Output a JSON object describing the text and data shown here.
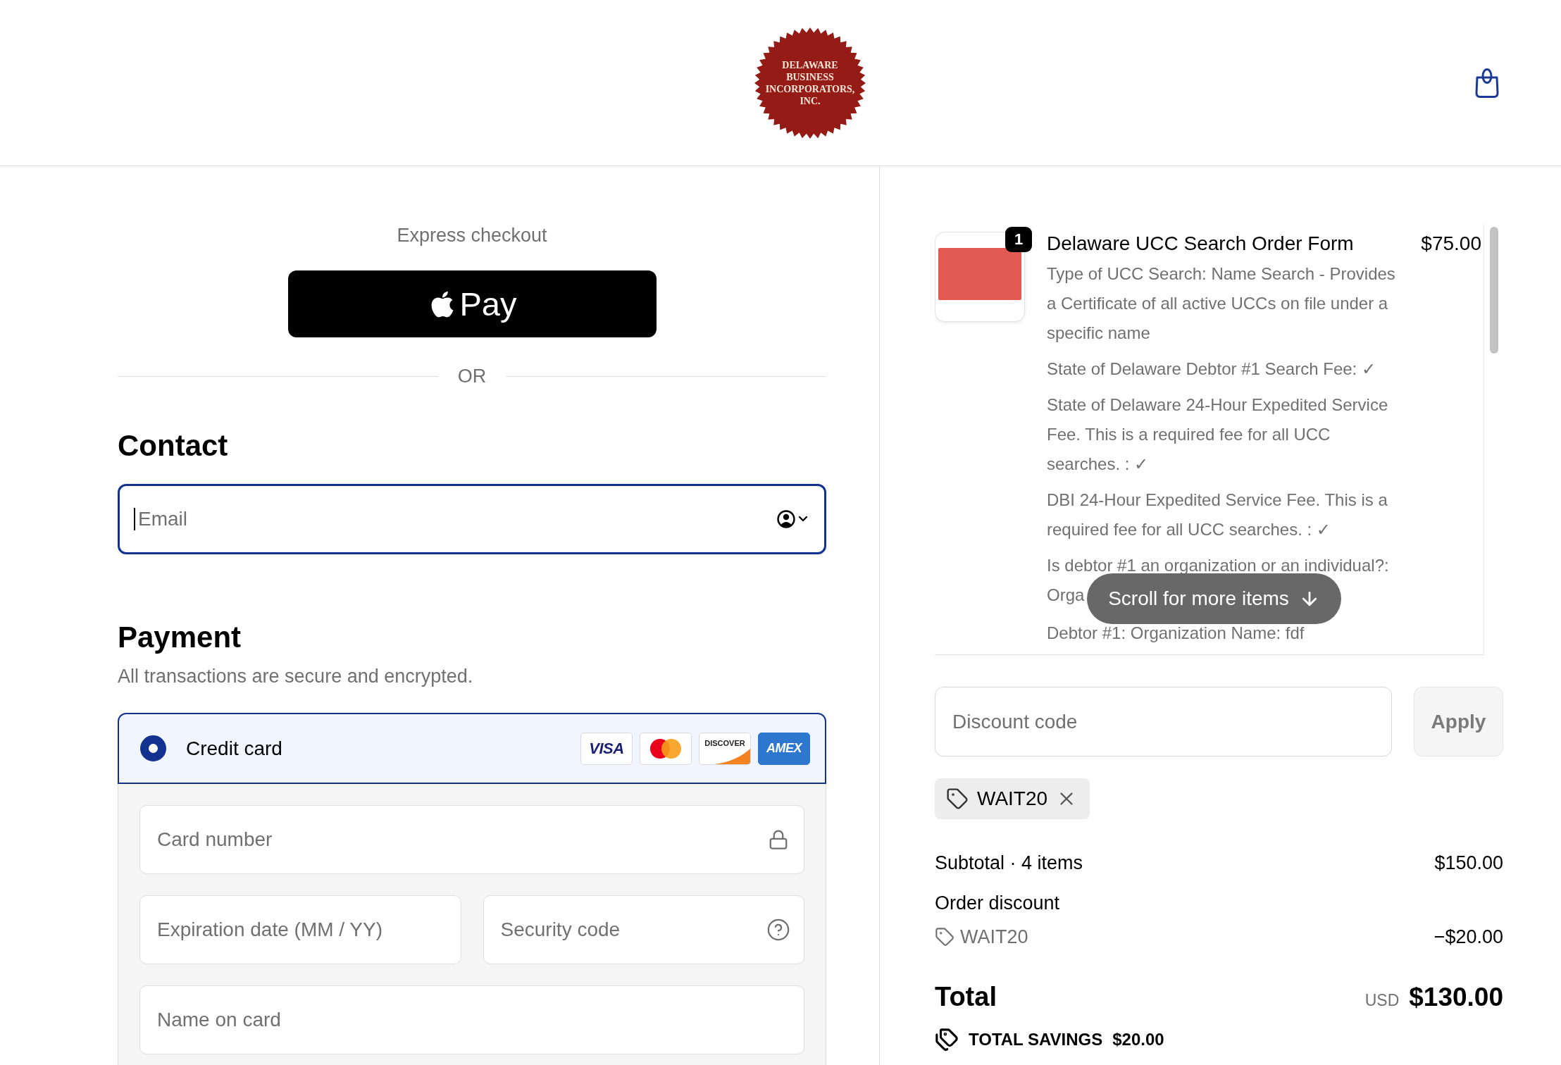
{
  "header": {
    "logo_lines": [
      "DELAWARE",
      "BUSINESS",
      "INCORPORATORS,",
      "INC."
    ]
  },
  "express_checkout": {
    "title": "Express checkout",
    "wallet_button": {
      "label": "Pay"
    },
    "separator": "OR"
  },
  "contact": {
    "heading": "Contact",
    "email": {
      "placeholder": "Email",
      "focused": true
    }
  },
  "payment": {
    "heading": "Payment",
    "subtitle": "All transactions are secure and encrypted.",
    "methods": [
      {
        "label": "Credit card",
        "selected": true,
        "card_brands": [
          {
            "kind": "visa",
            "label": "VISA"
          },
          {
            "kind": "mastercard"
          },
          {
            "kind": "discover",
            "label": "DISCOVER"
          },
          {
            "kind": "amex",
            "label": "AMEX"
          }
        ]
      }
    ],
    "card_fields": {
      "card_number": {
        "placeholder": "Card number"
      },
      "expiration": {
        "placeholder": "Expiration date (MM / YY)"
      },
      "security_code": {
        "placeholder": "Security code"
      },
      "name_on_card": {
        "placeholder": "Name on card"
      }
    }
  },
  "order_summary": {
    "items": [
      {
        "quantity": "1",
        "title": "Delaware UCC Search Order Form",
        "price": "$75.00",
        "details": [
          {
            "text": "Type of UCC Search: Name Search - Provides a Certificate of all active UCCs on file under a specific name"
          },
          {
            "text": "State of Delaware Debtor #1 Search Fee: ✓"
          },
          {
            "text": "State of Delaware 24-Hour Expedited Service Fee. This is a required fee for all UCC searches. : ✓"
          },
          {
            "text": "DBI 24-Hour Expedited Service Fee. This is a required fee for all UCC searches. : ✓"
          },
          {
            "lines": [
              "Is debtor #1 an organization or an individual?:",
              "Orga"
            ]
          },
          {
            "text": "Debtor #1: Organization Name: fdf"
          }
        ]
      }
    ],
    "scroll_hint": "Scroll for more items",
    "discount": {
      "placeholder": "Discount code",
      "apply_button": {
        "label": "Apply",
        "disabled": true
      },
      "applied_codes": [
        {
          "code": "WAIT20"
        }
      ]
    },
    "subtotal": {
      "label": "Subtotal · 4 items",
      "value": "$150.00"
    },
    "order_discount": {
      "label": "Order discount",
      "code": "WAIT20",
      "value": "−$20.00"
    },
    "total": {
      "label": "Total",
      "currency": "USD",
      "value": "$130.00"
    },
    "savings": {
      "label": "TOTAL SAVINGS",
      "value": "$20.00"
    }
  }
}
